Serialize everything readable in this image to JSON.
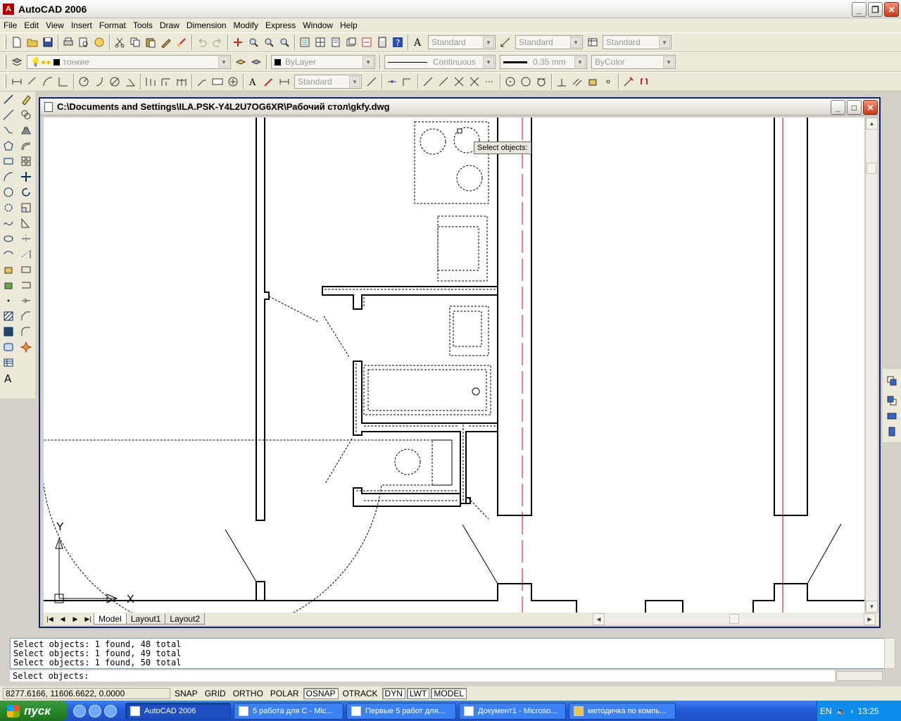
{
  "window": {
    "title": "AutoCAD 2006"
  },
  "menu": [
    "File",
    "Edit",
    "View",
    "Insert",
    "Format",
    "Tools",
    "Draw",
    "Dimension",
    "Modify",
    "Express",
    "Window",
    "Help"
  ],
  "toolbar1": {
    "text_style": "Standard",
    "dim_style": "Standard",
    "table_style": "Standard"
  },
  "toolbar2": {
    "layer": "тонкие",
    "color": "ByLayer",
    "linetype": "Continuous",
    "lineweight": "0.35 mm",
    "plotstyle": "ByColor"
  },
  "toolbar3": {
    "dim_style": "Standard"
  },
  "drawing": {
    "title": "C:\\Documents and Settings\\ILA.PSK-Y4L2U7OG6XR\\Рабочий стол\\gkfy.dwg",
    "tooltip": "Select objects:",
    "ucs_y": "Y",
    "ucs_x": "X",
    "tabs": [
      "Model",
      "Layout1",
      "Layout2"
    ]
  },
  "command": {
    "history": [
      "Select objects: 1 found, 48 total",
      "Select objects: 1 found, 49 total",
      "Select objects: 1 found, 50 total"
    ],
    "prompt": "Select objects:"
  },
  "status": {
    "coords": "8277.6166, 11606.6622, 0.0000",
    "buttons": [
      {
        "label": "SNAP",
        "on": false
      },
      {
        "label": "GRID",
        "on": false
      },
      {
        "label": "ORTHO",
        "on": false
      },
      {
        "label": "POLAR",
        "on": false
      },
      {
        "label": "OSNAP",
        "on": true
      },
      {
        "label": "OTRACK",
        "on": false
      },
      {
        "label": "DYN",
        "on": true
      },
      {
        "label": "LWT",
        "on": true
      },
      {
        "label": "MODEL",
        "on": true
      }
    ]
  },
  "taskbar": {
    "start": "пуск",
    "tasks": [
      "AutoCAD 2006",
      "5 работа для С - Mic...",
      "Первые 5 работ для...",
      "Документ1 - Microso...",
      "методичка по компь..."
    ],
    "lang": "EN",
    "clock": "13:25"
  }
}
